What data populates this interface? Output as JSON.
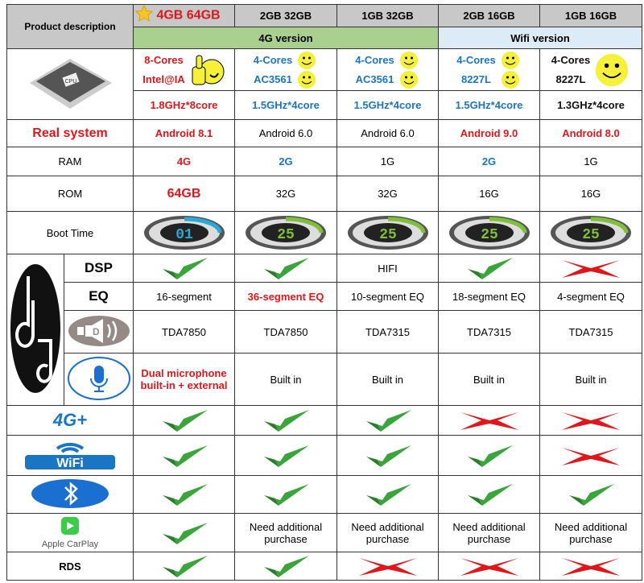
{
  "header": {
    "product_description": "Product description",
    "models": [
      "4GB 64GB",
      "2GB 32GB",
      "1GB 32GB",
      "2GB 16GB",
      "1GB 16GB"
    ],
    "version_4g": "4G version",
    "version_wifi": "Wifi version"
  },
  "colors": {
    "red": "#e0161b",
    "blue": "#1a75c4",
    "check": "#3aa53a",
    "cross": "#e0161b",
    "green_band": "#a9d08e",
    "blue_band": "#ddebf7"
  },
  "cpu": {
    "icon": "cpu-chip-icon",
    "chip_label": "CPU",
    "cores": [
      {
        "l1": "8-Cores",
        "l2": "Intel@IA",
        "style": "red",
        "icon": "thumbs-up-smiley-icon"
      },
      {
        "l1": "4-Cores",
        "l2": "AC3561",
        "style": "blue",
        "icon": "smiley-icon"
      },
      {
        "l1": "4-Cores",
        "l2": "AC3561",
        "style": "blue",
        "icon": "smiley-icon"
      },
      {
        "l1": "4-Cores",
        "l2": "8227L",
        "style": "blue",
        "icon": "smiley-icon"
      },
      {
        "l1": "4-Cores",
        "l2": "8227L",
        "style": "blk",
        "icon": "smiley-icon"
      }
    ],
    "freq": [
      {
        "v": "1.8GHz*8core",
        "style": "red"
      },
      {
        "v": "1.5GHz*4core",
        "style": "blue"
      },
      {
        "v": "1.5GHz*4core",
        "style": "blue"
      },
      {
        "v": "1.5GHz*4core",
        "style": "blue"
      },
      {
        "v": "1.3GHz*4core",
        "style": "blk"
      }
    ]
  },
  "real_system": {
    "label": "Real system",
    "values": [
      {
        "v": "Android 8.1",
        "style": "red"
      },
      {
        "v": "Android 6.0",
        "style": ""
      },
      {
        "v": "Android 6.0",
        "style": ""
      },
      {
        "v": "Android 9.0",
        "style": "red"
      },
      {
        "v": "Android 8.0",
        "style": "red"
      }
    ]
  },
  "ram": {
    "label": "RAM",
    "values": [
      {
        "v": "4G",
        "style": "red"
      },
      {
        "v": "2G",
        "style": "blue"
      },
      {
        "v": "1G",
        "style": ""
      },
      {
        "v": "2G",
        "style": "blue"
      },
      {
        "v": "1G",
        "style": ""
      }
    ]
  },
  "rom": {
    "label": "ROM",
    "values": [
      {
        "v": "64GB",
        "style": "red big"
      },
      {
        "v": "32G",
        "style": ""
      },
      {
        "v": "32G",
        "style": ""
      },
      {
        "v": "16G",
        "style": ""
      },
      {
        "v": "16G",
        "style": ""
      }
    ]
  },
  "boot": {
    "label": "Boot Time",
    "values": [
      "01",
      "25",
      "25",
      "25",
      "25"
    ]
  },
  "dsp": {
    "label": "DSP",
    "values": [
      "check",
      "check",
      "HIFI",
      "check",
      "cross"
    ]
  },
  "eq": {
    "label": "EQ",
    "values": [
      {
        "v": "16-segment",
        "style": ""
      },
      {
        "v": "36-segment EQ",
        "style": "red"
      },
      {
        "v": "10-segment EQ",
        "style": ""
      },
      {
        "v": "18-segment EQ",
        "style": ""
      },
      {
        "v": "4-segment EQ",
        "style": ""
      }
    ]
  },
  "amp": {
    "icon": "speaker-icon",
    "badge": "D",
    "values": [
      "TDA7850",
      "TDA7850",
      "TDA7315",
      "TDA7315",
      "TDA7315"
    ]
  },
  "mic": {
    "icon": "microphone-icon",
    "values": [
      "Dual microphone built-in + external",
      "Built in",
      "Built in",
      "Built in",
      "Built in"
    ]
  },
  "lte": {
    "label": "4G+",
    "values": [
      "check",
      "check",
      "check",
      "cross",
      "cross"
    ]
  },
  "wifi": {
    "label": "WiFi",
    "values": [
      "check",
      "check",
      "check",
      "check",
      "cross"
    ]
  },
  "bluetooth": {
    "icon": "bluetooth-icon",
    "values": [
      "check",
      "check",
      "check",
      "check",
      "check"
    ]
  },
  "carplay": {
    "label": "Apple CarPlay",
    "values": [
      "check",
      "Need additional purchase",
      "Need additional purchase",
      "Need additional purchase",
      "Need additional purchase"
    ]
  },
  "rds": {
    "label": "RDS",
    "values": [
      "check",
      "check",
      "cross",
      "cross",
      "cross"
    ]
  }
}
